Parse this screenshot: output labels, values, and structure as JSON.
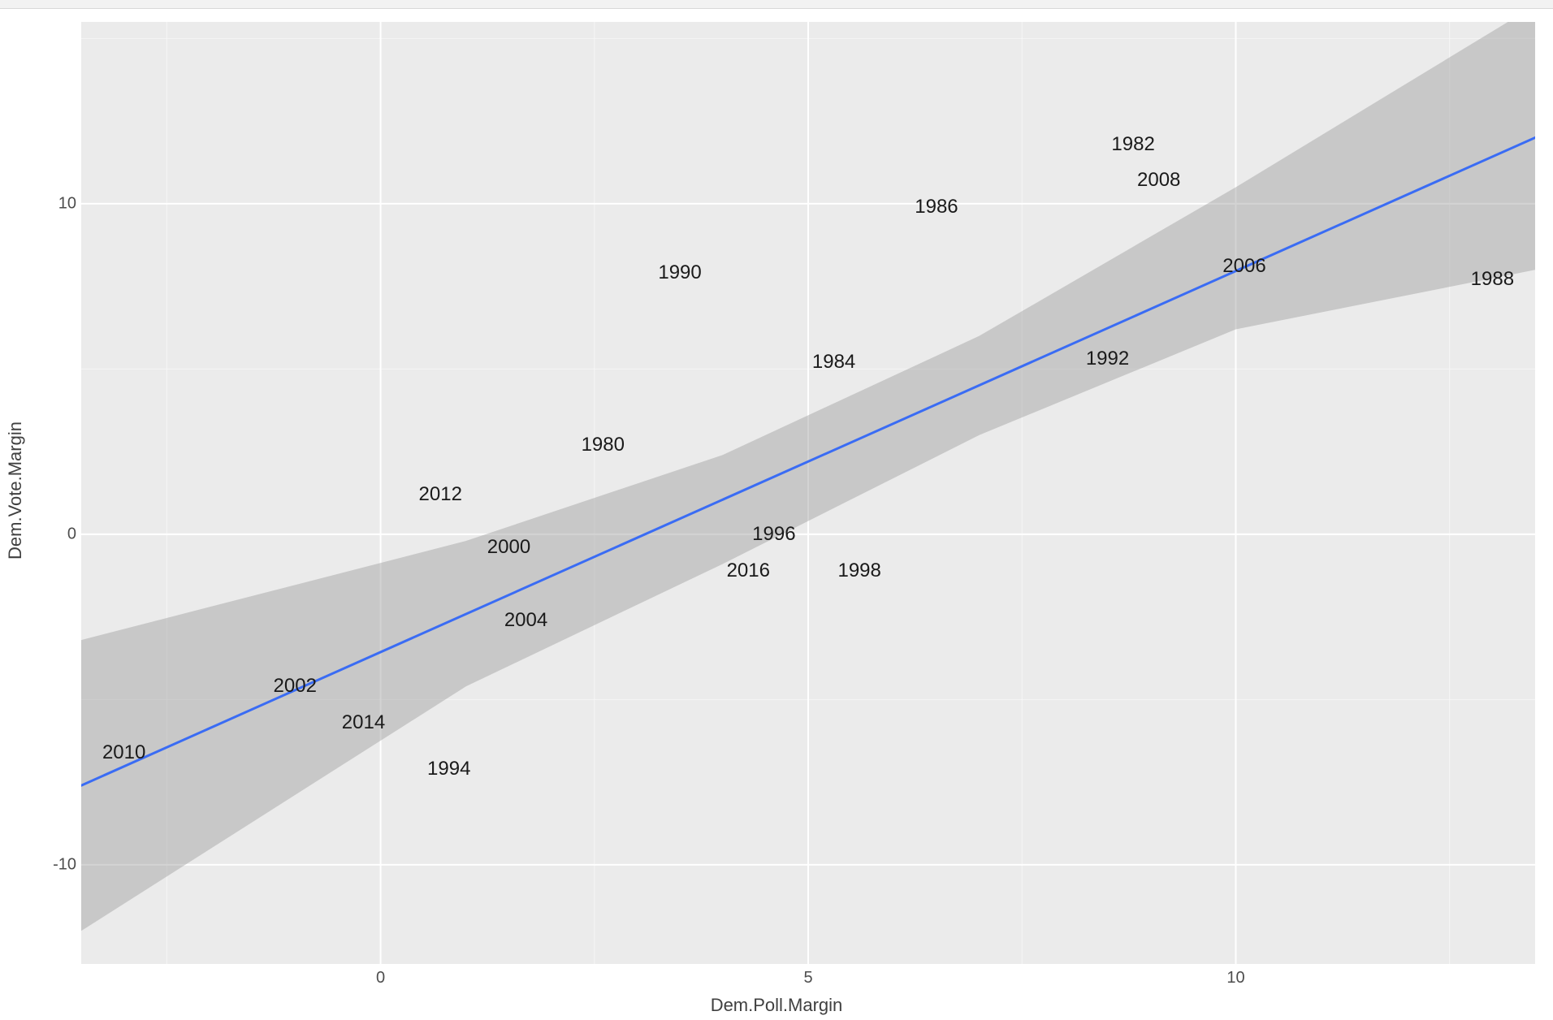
{
  "chart_data": {
    "type": "scatter",
    "xlabel": "Dem.Poll.Margin",
    "ylabel": "Dem.Vote.Margin",
    "xlim": [
      -3.5,
      13.5
    ],
    "ylim": [
      -13.0,
      15.5
    ],
    "x_ticks": [
      0,
      5,
      10
    ],
    "y_ticks": [
      -10,
      0,
      10
    ],
    "points": [
      {
        "label": "2010",
        "x": -3.0,
        "y": -6.6
      },
      {
        "label": "2002",
        "x": -1.0,
        "y": -4.6
      },
      {
        "label": "2014",
        "x": -0.2,
        "y": -5.7
      },
      {
        "label": "2012",
        "x": 0.7,
        "y": 1.2
      },
      {
        "label": "1994",
        "x": 0.8,
        "y": -7.1
      },
      {
        "label": "2000",
        "x": 1.5,
        "y": -0.4
      },
      {
        "label": "2004",
        "x": 1.7,
        "y": -2.6
      },
      {
        "label": "1980",
        "x": 2.6,
        "y": 2.7
      },
      {
        "label": "1990",
        "x": 3.5,
        "y": 7.9
      },
      {
        "label": "2016",
        "x": 4.3,
        "y": -1.1
      },
      {
        "label": "1996",
        "x": 4.6,
        "y": 0.0
      },
      {
        "label": "1984",
        "x": 5.3,
        "y": 5.2
      },
      {
        "label": "1998",
        "x": 5.6,
        "y": -1.1
      },
      {
        "label": "1986",
        "x": 6.5,
        "y": 9.9
      },
      {
        "label": "1992",
        "x": 8.5,
        "y": 5.3
      },
      {
        "label": "1982",
        "x": 8.8,
        "y": 11.8
      },
      {
        "label": "2008",
        "x": 9.1,
        "y": 10.7
      },
      {
        "label": "2006",
        "x": 10.1,
        "y": 8.1
      },
      {
        "label": "1988",
        "x": 13.0,
        "y": 7.7
      }
    ],
    "regression": {
      "color": "#3a6cf4",
      "line": [
        {
          "x": -3.5,
          "y": -7.6
        },
        {
          "x": 13.5,
          "y": 12.0
        }
      ],
      "ribbon_upper": [
        {
          "x": -3.5,
          "y": -3.2
        },
        {
          "x": 1.0,
          "y": -0.2
        },
        {
          "x": 4.0,
          "y": 2.4
        },
        {
          "x": 7.0,
          "y": 6.0
        },
        {
          "x": 10.0,
          "y": 10.5
        },
        {
          "x": 13.5,
          "y": 16.0
        }
      ],
      "ribbon_lower": [
        {
          "x": 13.5,
          "y": 8.0
        },
        {
          "x": 10.0,
          "y": 6.2
        },
        {
          "x": 7.0,
          "y": 3.0
        },
        {
          "x": 4.0,
          "y": -0.9
        },
        {
          "x": 1.0,
          "y": -4.6
        },
        {
          "x": -3.5,
          "y": -12.0
        }
      ]
    }
  }
}
